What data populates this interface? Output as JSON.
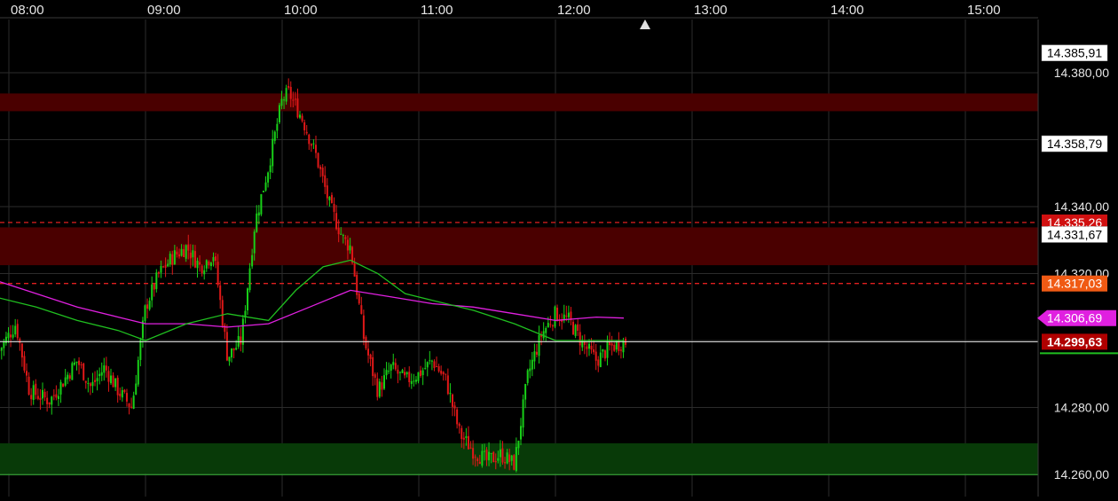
{
  "chart_data": {
    "type": "candlestick",
    "x_axis": {
      "ticks": [
        "08:00",
        "09:00",
        "10:00",
        "11:00",
        "12:00",
        "13:00",
        "14:00",
        "15:00"
      ]
    },
    "y_axis": {
      "ticks": [
        "14.380,00",
        "14.340,00",
        "14.320,00",
        "14.280,00",
        "14.260,00"
      ],
      "tick_values": [
        14380,
        14340,
        14320,
        14280,
        14260
      ],
      "range": [
        14255,
        14392
      ]
    },
    "zones": [
      {
        "kind": "resistance",
        "from": 14368.5,
        "to": 14373.8,
        "color": "#4a0000"
      },
      {
        "kind": "resistance",
        "from": 14322.5,
        "to": 14333.8,
        "color": "#4a0000"
      },
      {
        "kind": "support",
        "from": 14260.2,
        "to": 14269.3,
        "color": "#083a08"
      }
    ],
    "price_tags": [
      {
        "text": "14.385,91",
        "value": 14385.91,
        "bg": "#ffffff",
        "fg": "#000000"
      },
      {
        "text": "14.358,79",
        "value": 14358.79,
        "bg": "#ffffff",
        "fg": "#000000"
      },
      {
        "text": "14.335,26",
        "value": 14335.26,
        "bg": "#d01010",
        "fg": "#ffffff"
      },
      {
        "text": "14.331,67",
        "value": 14331.67,
        "bg": "#ffffff",
        "fg": "#000000"
      },
      {
        "text": "14.317,03",
        "value": 14317.03,
        "bg": "#f05a14",
        "fg": "#ffffff"
      },
      {
        "text": "14.306,69",
        "value": 14306.69,
        "bg": "#e020e0",
        "fg": "#ffffff"
      },
      {
        "text": "14.299,63",
        "value": 14299.63,
        "bg": "#b00000",
        "fg": "#ffffff"
      }
    ],
    "dashed_levels": [
      14335.26,
      14317.03
    ],
    "last_price": 14299.63,
    "moving_averages": [
      {
        "color": "#e020e0",
        "hours": [
          7.9,
          8.2,
          8.5,
          8.8,
          9.0,
          9.3,
          9.6,
          9.9,
          10.2,
          10.5,
          10.8,
          11.1,
          11.4,
          11.7,
          12.0,
          12.3,
          12.5
        ],
        "values": [
          14318,
          14314,
          14310,
          14307,
          14305,
          14305,
          14304,
          14305,
          14310,
          14315,
          14313,
          14311,
          14310,
          14308,
          14306,
          14307,
          14306.7
        ]
      },
      {
        "color": "#20c020",
        "hours": [
          7.9,
          8.2,
          8.5,
          8.8,
          9.0,
          9.3,
          9.6,
          9.9,
          10.1,
          10.3,
          10.5,
          10.7,
          10.9,
          11.1,
          11.4,
          11.7,
          12.0,
          12.3,
          12.5
        ],
        "values": [
          14313,
          14310,
          14306,
          14303,
          14300,
          14305,
          14308,
          14306,
          14315,
          14322,
          14324,
          14320,
          14314,
          14312,
          14309,
          14305,
          14300,
          14300,
          14300
        ]
      }
    ],
    "price_path": {
      "hours": [
        7.9,
        8.05,
        8.15,
        8.3,
        8.4,
        8.5,
        8.6,
        8.7,
        8.8,
        8.9,
        9.0,
        9.1,
        9.2,
        9.3,
        9.4,
        9.5,
        9.6,
        9.7,
        9.8,
        9.9,
        10.0,
        10.05,
        10.15,
        10.25,
        10.35,
        10.45,
        10.5,
        10.6,
        10.7,
        10.8,
        10.9,
        11.0,
        11.1,
        11.2,
        11.3,
        11.4,
        11.5,
        11.6,
        11.7,
        11.8,
        11.9,
        12.0,
        12.1,
        12.2,
        12.3,
        12.4,
        12.5
      ],
      "values": [
        14295,
        14305,
        14285,
        14282,
        14288,
        14294,
        14286,
        14292,
        14285,
        14280,
        14310,
        14320,
        14325,
        14328,
        14322,
        14326,
        14295,
        14300,
        14335,
        14352,
        14372,
        14374,
        14366,
        14355,
        14340,
        14330,
        14328,
        14300,
        14285,
        14292,
        14288,
        14290,
        14294,
        14288,
        14272,
        14267,
        14264,
        14266,
        14263,
        14290,
        14302,
        14308,
        14306,
        14299,
        14294,
        14298,
        14299.63
      ]
    }
  }
}
